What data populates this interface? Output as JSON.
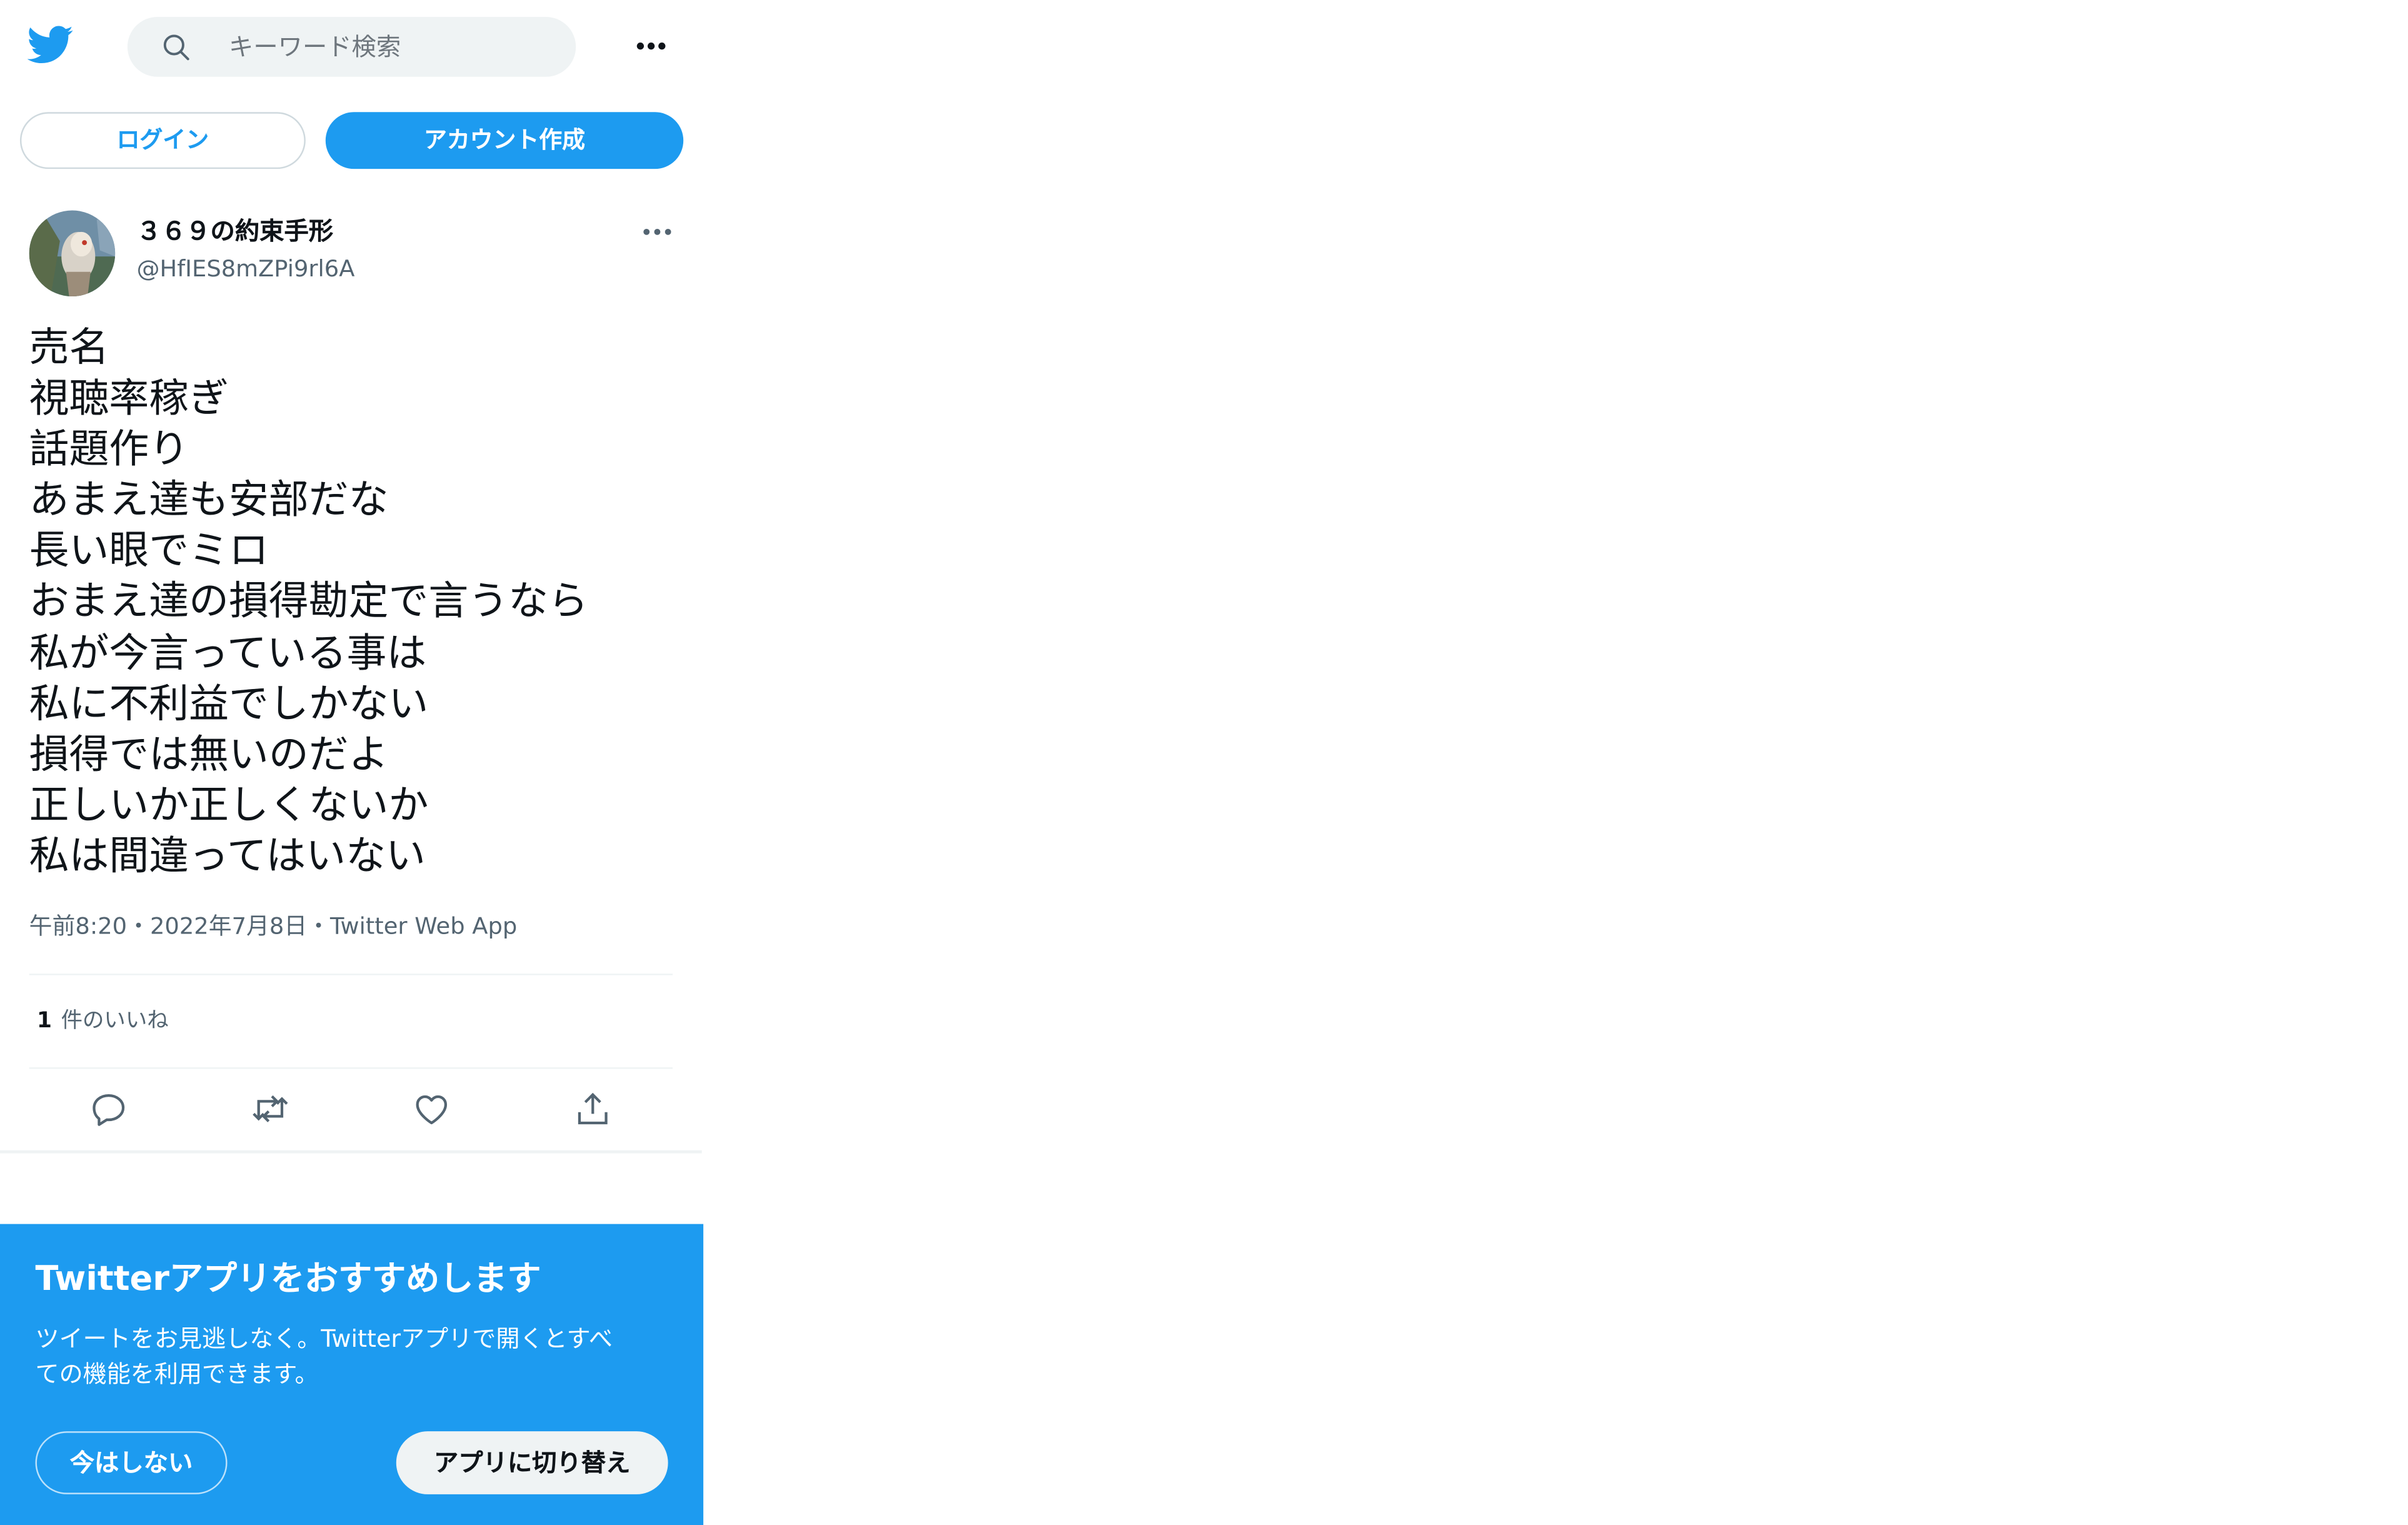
{
  "header": {
    "logo_icon": "twitter-bird-icon",
    "search": {
      "icon": "search-icon",
      "placeholder": "キーワード検索"
    },
    "more_icon": "more-horizontal-icon"
  },
  "auth": {
    "login_label": "ログイン",
    "signup_label": "アカウント作成"
  },
  "tweet": {
    "author": {
      "display_name": "３６９の約束手形",
      "handle": "@HfIES8mZPi9rl6A"
    },
    "more_icon": "more-horizontal-icon",
    "lines": [
      "売名",
      "視聴率稼ぎ",
      "話題作り",
      "あまえ達も安部だな",
      "長い眼でミロ",
      "おまえ達の損得勘定で言うなら",
      "私が今言っている事は",
      "私に不利益でしかない",
      "損得では無いのだよ",
      "正しいか正しくないか",
      "私は間違ってはいない"
    ],
    "meta": "午前8:20・2022年7月8日・Twitter Web App",
    "likes_count": "1",
    "likes_label": "件のいいね",
    "actions": [
      "reply-icon",
      "retweet-icon",
      "like-icon",
      "share-icon"
    ]
  },
  "banner": {
    "title": "Twitterアプリをおすすめします",
    "body_lines": [
      "ツイートをお見逃しなく。Twitterアプリで開くとすべ",
      "ての機能を利用できます。"
    ],
    "later_label": "今はしない",
    "switch_label": "アプリに切り替え"
  },
  "colors": {
    "brand": "#1d9bf0",
    "text_primary": "#0f1419",
    "text_secondary": "#536471",
    "search_bg": "#eff3f4"
  }
}
